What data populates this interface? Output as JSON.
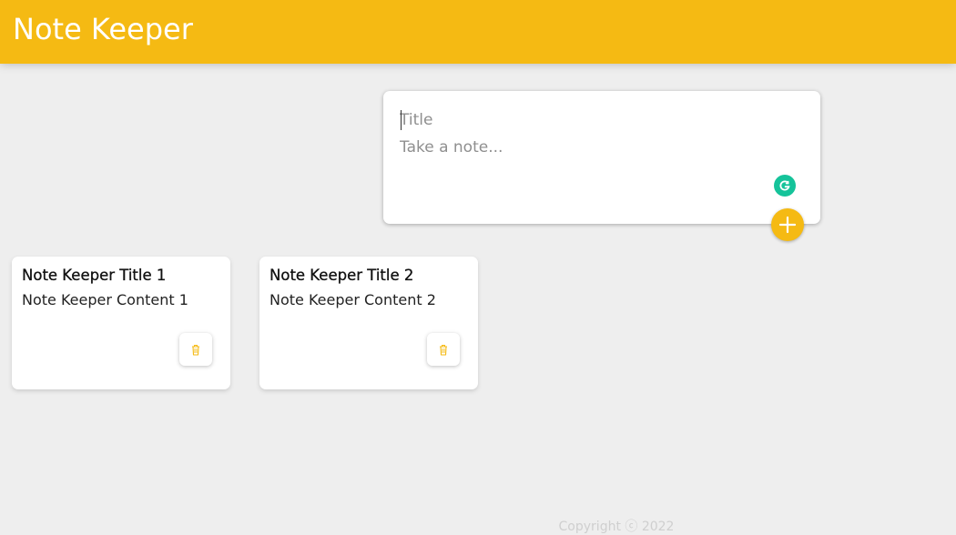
{
  "app": {
    "title": "Note Keeper"
  },
  "create_note": {
    "title_placeholder": "Title",
    "content_placeholder": "Take a note...",
    "add_icon": "plus-icon",
    "assistant_icon": "grammarly-icon"
  },
  "notes": [
    {
      "title": "Note Keeper Title 1",
      "content": "Note Keeper Content 1",
      "delete_icon": "trash-icon"
    },
    {
      "title": "Note Keeper Title 2",
      "content": "Note Keeper Content 2",
      "delete_icon": "trash-icon"
    }
  ],
  "footer": {
    "text": "Copyright ⓒ 2022"
  },
  "colors": {
    "accent": "#f5ba13",
    "background": "#eeeeee",
    "card": "#ffffff",
    "grammarly": "#15c39a"
  }
}
